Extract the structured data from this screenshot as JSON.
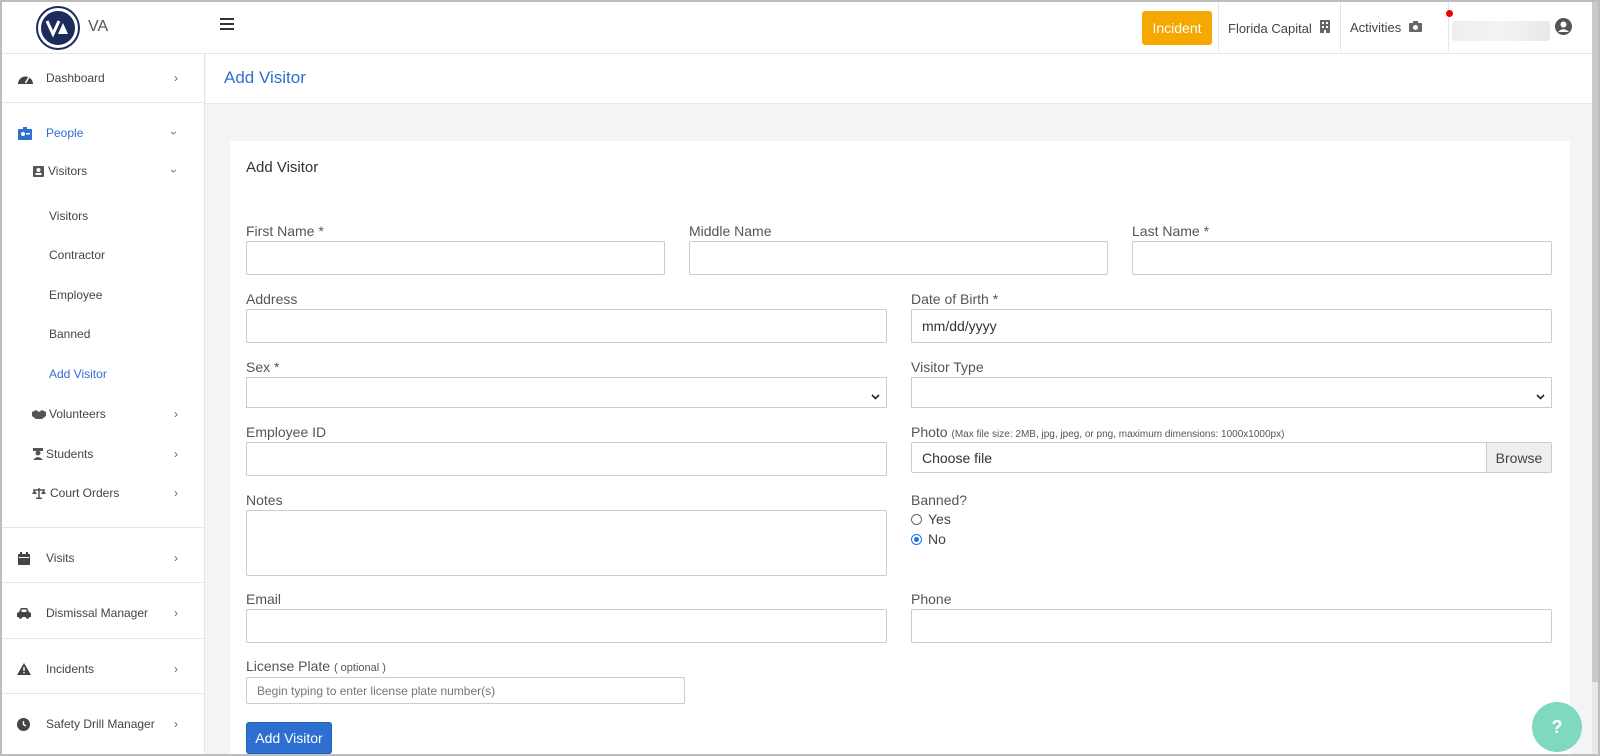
{
  "app": {
    "logo_text": "VA"
  },
  "topbar": {
    "incident_label": "Incident",
    "location_label": "Florida Capital",
    "activities_label": "Activities"
  },
  "sidebar": {
    "dashboard": "Dashboard",
    "people": "People",
    "visitors_group": "Visitors",
    "visitors": "Visitors",
    "contractor": "Contractor",
    "employee": "Employee",
    "banned": "Banned",
    "add_visitor": "Add Visitor",
    "volunteers": "Volunteers",
    "students": "Students",
    "court_orders": "Court Orders",
    "visits": "Visits",
    "dismissal_manager": "Dismissal Manager",
    "incidents": "Incidents",
    "safety_drill_manager": "Safety Drill Manager"
  },
  "page": {
    "title": "Add Visitor"
  },
  "form": {
    "card_title": "Add Visitor",
    "first_name_label": "First Name *",
    "middle_name_label": "Middle Name",
    "last_name_label": "Last Name *",
    "address_label": "Address",
    "dob_label": "Date of Birth *",
    "dob_placeholder": "mm/dd/yyyy",
    "sex_label": "Sex *",
    "visitor_type_label": "Visitor Type",
    "employee_id_label": "Employee ID",
    "photo_label": "Photo",
    "photo_hint": "(Max file size: 2MB, jpg, jpeg, or png, maximum dimensions: 1000x1000px)",
    "photo_choose": "Choose file",
    "photo_browse": "Browse",
    "notes_label": "Notes",
    "banned_label": "Banned?",
    "banned_yes": "Yes",
    "banned_no": "No",
    "email_label": "Email",
    "phone_label": "Phone",
    "plate_label": "License Plate",
    "plate_optional": "( optional )",
    "plate_placeholder": "Begin typing to enter license plate number(s)",
    "submit_label": "Add Visitor"
  },
  "help": {
    "label": "?"
  },
  "colors": {
    "accent": "#2f6fcf",
    "incident": "#f5a800",
    "submit": "#2d6fd1",
    "help": "#7fd8c0"
  }
}
